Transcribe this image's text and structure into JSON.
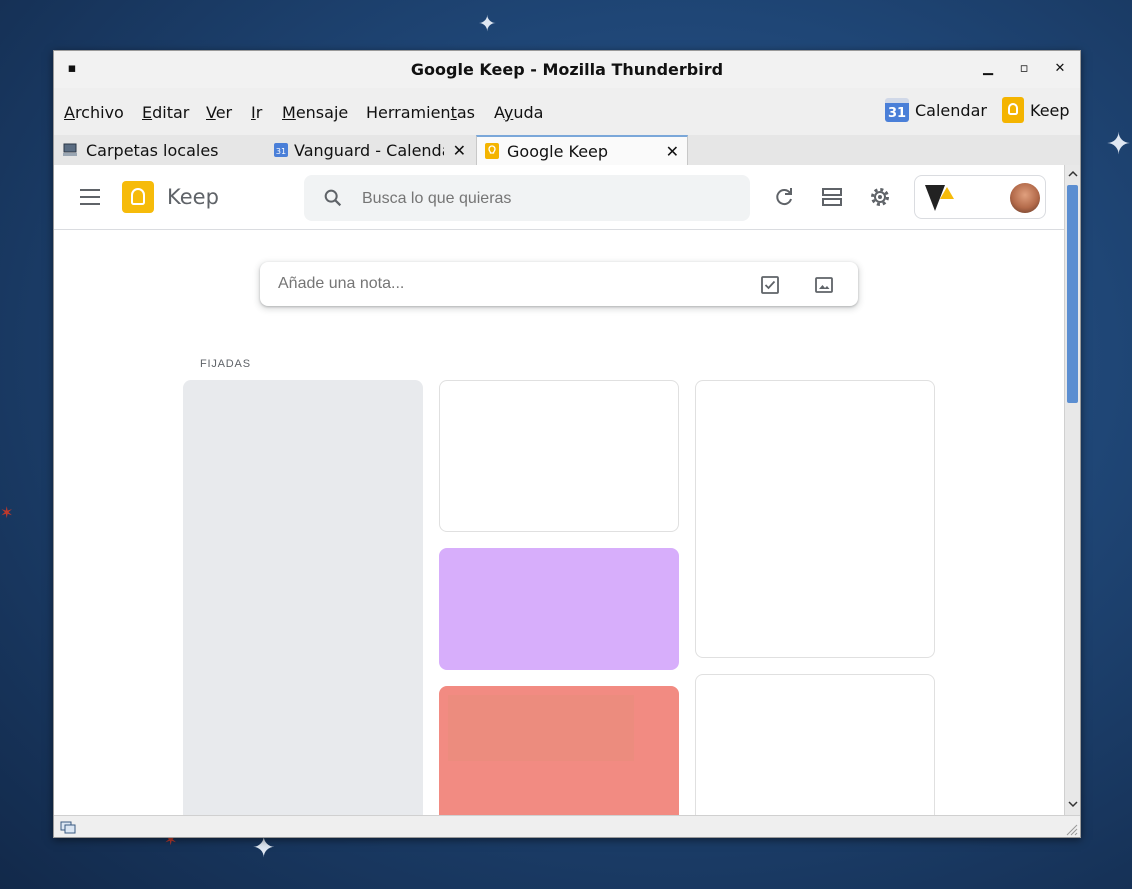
{
  "window": {
    "title": "Google Keep - Mozilla Thunderbird"
  },
  "menu": {
    "items": [
      {
        "pre": "",
        "u": "A",
        "post": "rchivo"
      },
      {
        "pre": "",
        "u": "E",
        "post": "ditar"
      },
      {
        "pre": "",
        "u": "V",
        "post": "er"
      },
      {
        "pre": "",
        "u": "I",
        "post": "r"
      },
      {
        "pre": "",
        "u": "M",
        "post": "ensaje"
      },
      {
        "pre": "Herramien",
        "u": "t",
        "post": "as"
      },
      {
        "pre": "A",
        "u": "y",
        "post": "uda"
      }
    ],
    "calendar_label": "Calendar",
    "calendar_day": "31",
    "keep_label": "Keep"
  },
  "tabs": [
    {
      "label": "Carpetas locales"
    },
    {
      "label": "Vanguard - Calendar"
    },
    {
      "label": "Google Keep"
    }
  ],
  "keep": {
    "app_name": "Keep",
    "search_placeholder": "Busca lo que quieras",
    "note_placeholder": "Añade una nota...",
    "pinned_label": "FIJADAS"
  },
  "colors": {
    "card_gray": "#e8eaed",
    "card_purple": "#d7aefb",
    "card_red": "#f28b82",
    "accent_yellow": "#f6bb0a"
  }
}
